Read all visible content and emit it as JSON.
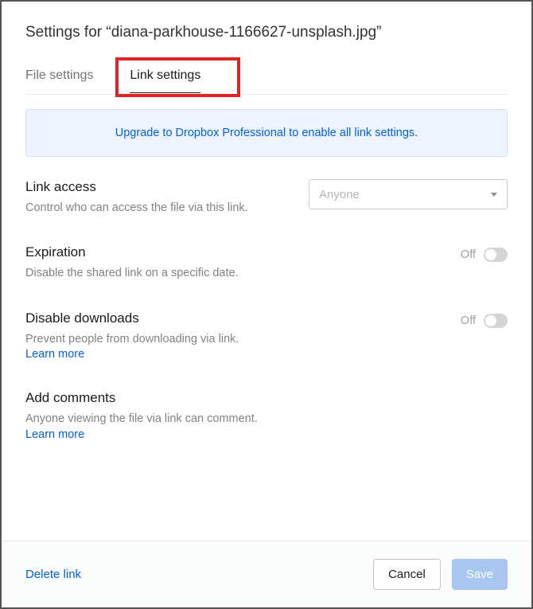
{
  "title": "Settings for “diana-parkhouse-1166627-unsplash.jpg”",
  "tabs": {
    "file_settings": "File settings",
    "link_settings": "Link settings"
  },
  "banner": "Upgrade to Dropbox Professional to enable all link settings.",
  "link_access": {
    "title": "Link access",
    "desc": "Control who can access the file via this link.",
    "selected": "Anyone"
  },
  "expiration": {
    "title": "Expiration",
    "desc": "Disable the shared link on a specific date.",
    "state": "Off"
  },
  "disable_downloads": {
    "title": "Disable downloads",
    "desc": "Prevent people from downloading via link.",
    "learn_more": "Learn more",
    "state": "Off"
  },
  "add_comments": {
    "title": "Add comments",
    "desc": "Anyone viewing the file via link can comment. ",
    "learn_more": "Learn more"
  },
  "footer": {
    "delete": "Delete link",
    "cancel": "Cancel",
    "save": "Save"
  }
}
